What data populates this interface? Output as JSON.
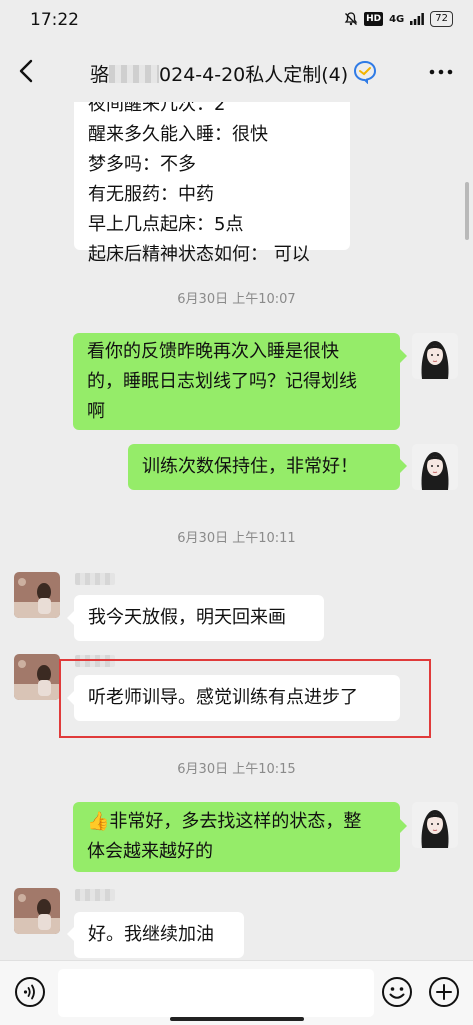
{
  "status_bar": {
    "time": "17:22",
    "hd": "HD",
    "network": "4G",
    "battery": "72"
  },
  "header": {
    "title_prefix": "骆",
    "title_suffix": "024-4-20私人定制(4)"
  },
  "messages": {
    "m0": {
      "lines": [
        "夜间醒来几次：2",
        "醒来多久能入睡：很快",
        "梦多吗：不多",
        "有无服药：中药",
        "早上几点起床：5点",
        "起床后精神状态如何： 可以"
      ]
    },
    "t1": "6月30日 上午10:07",
    "m1": {
      "lines": [
        "看你的反馈昨晚再次入睡是很快",
        "的，睡眠日志划线了吗？记得划线",
        "啊"
      ]
    },
    "m2": {
      "text": "训练次数保持住，非常好！"
    },
    "t2": "6月30日 上午10:11",
    "m3": {
      "text": "我今天放假，明天回来画"
    },
    "m4": {
      "text": "听老师训导。感觉训练有点进步了"
    },
    "t3": "6月30日 上午10:15",
    "m5": {
      "lines": [
        "非常好，多去找这样的状态，整",
        "体会越来越好的"
      ],
      "emoji": "👍"
    },
    "m6": {
      "text": "好。我继续加油"
    }
  },
  "colors": {
    "background": "#ededed",
    "outgoing_bubble": "#95ec69",
    "incoming_bubble": "#ffffff",
    "highlight": "#e03a3a"
  },
  "icons": [
    "back-icon",
    "enterprise-badge-icon",
    "more-icon",
    "voice-icon",
    "emoji-icon",
    "plus-icon"
  ]
}
